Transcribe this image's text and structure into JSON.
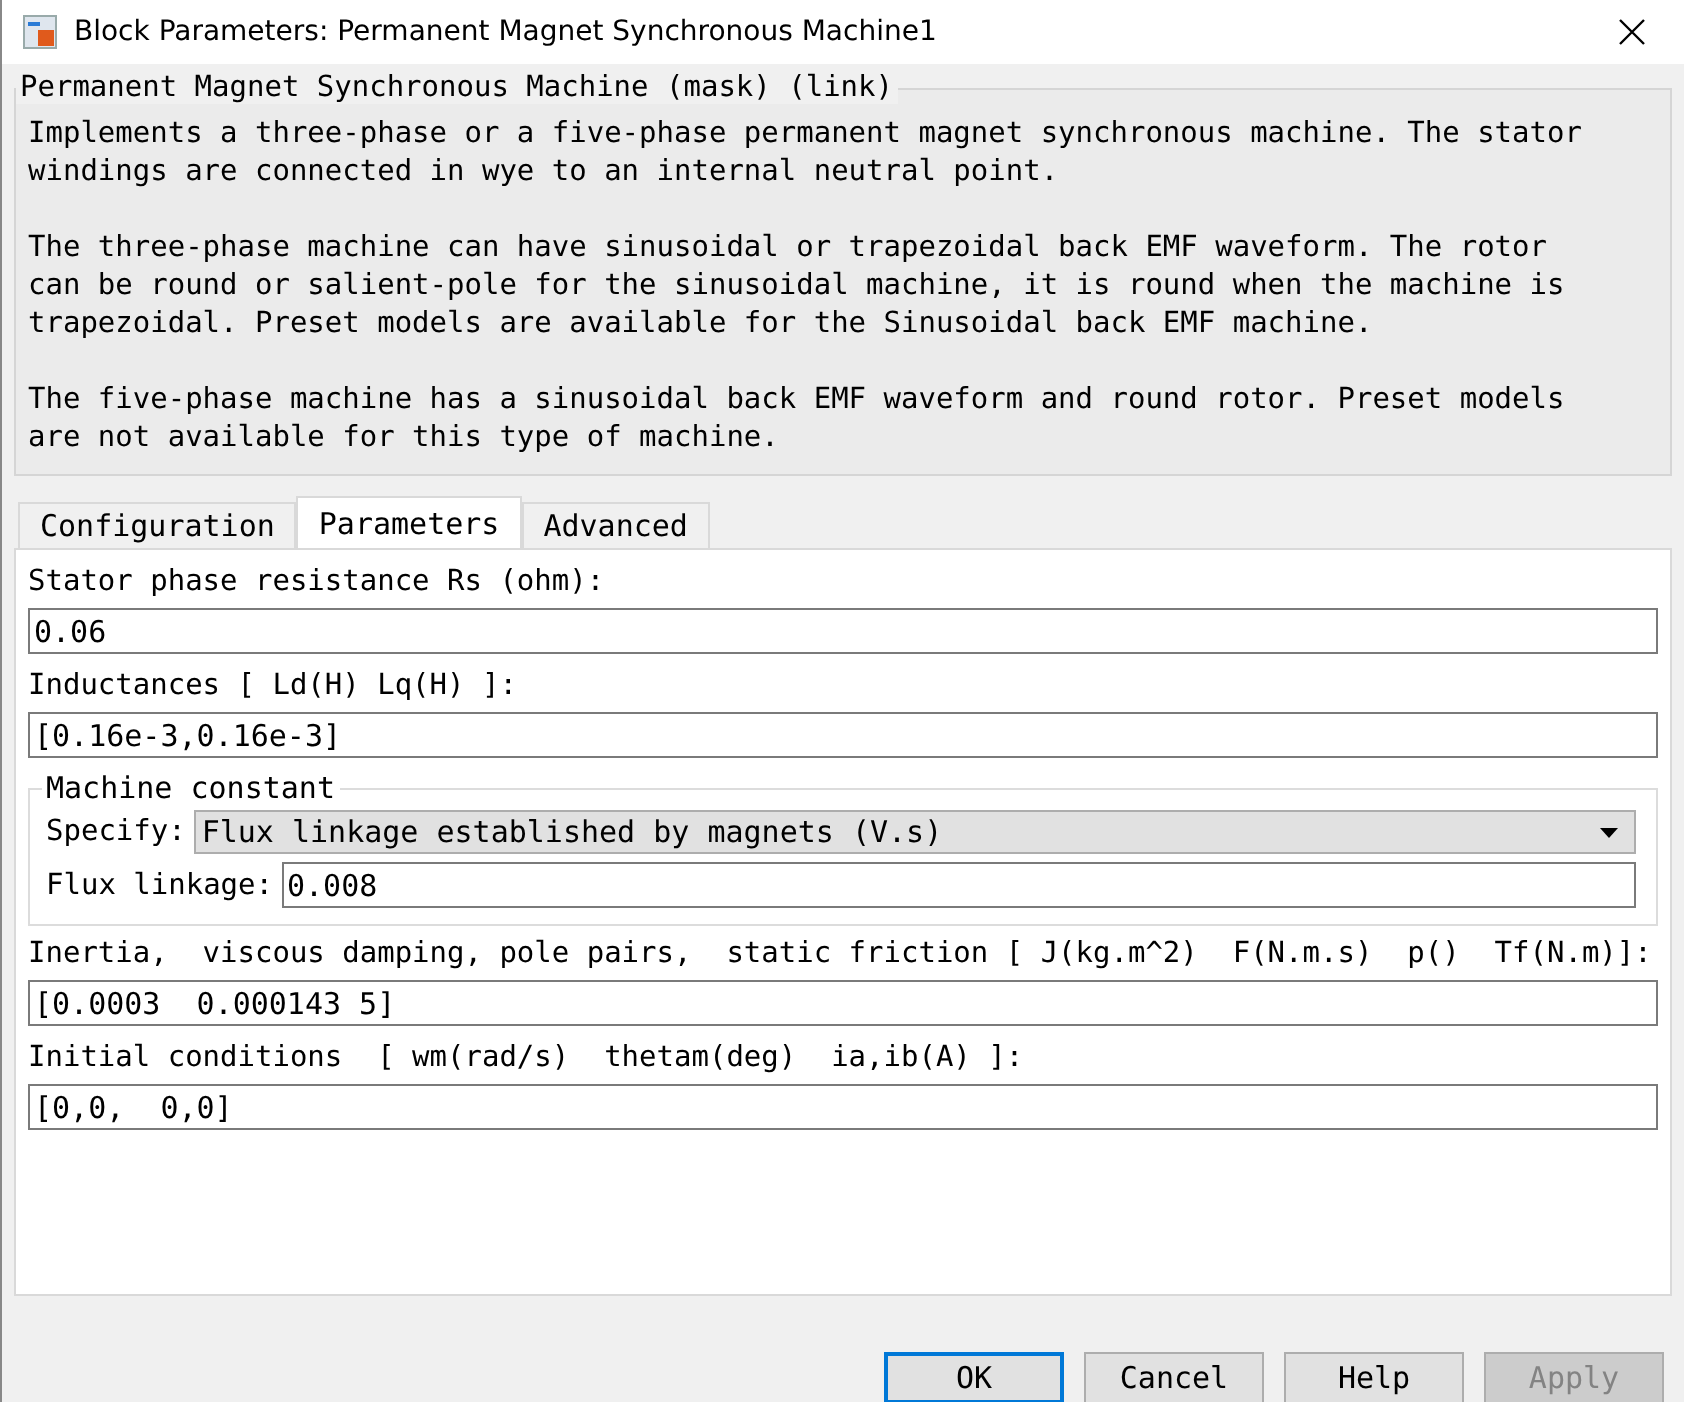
{
  "window": {
    "title": "Block Parameters: Permanent Magnet Synchronous Machine1"
  },
  "description": {
    "title": "Permanent Magnet Synchronous Machine (mask) (link)",
    "paragraphs": [
      "Implements a three-phase or a five-phase permanent magnet synchronous machine. The stator windings are connected in wye to an internal neutral point.",
      "The three-phase machine can have sinusoidal or trapezoidal back EMF waveform. The rotor can be round or salient-pole for the sinusoidal machine, it is round when the machine is trapezoidal. Preset models are available for the Sinusoidal back EMF machine.",
      "The five-phase machine has a sinusoidal back EMF waveform and round rotor. Preset models are not available for this type of machine."
    ]
  },
  "tabs": [
    {
      "label": "Configuration",
      "selected": false
    },
    {
      "label": "Parameters",
      "selected": true
    },
    {
      "label": "Advanced",
      "selected": false
    }
  ],
  "parameters": [
    {
      "kind": "text",
      "label": "Stator phase resistance Rs (ohm):",
      "value": "0.06"
    },
    {
      "kind": "text",
      "label": "Inductances [ Ld(H) Lq(H) ]:",
      "value": "[0.16e-3,0.16e-3]"
    },
    {
      "kind": "group",
      "title": "Machine constant",
      "items": [
        {
          "kind": "select",
          "label": "Specify:",
          "value": "Flux linkage established by magnets (V.s)"
        },
        {
          "kind": "inline",
          "label": "Flux linkage:",
          "value": "0.008"
        }
      ]
    },
    {
      "kind": "text",
      "label": "Inertia,  viscous damping, pole pairs,  static friction [ J(kg.m^2)  F(N.m.s)  p()  Tf(N.m)]:",
      "value": "[0.0003  0.000143 5]"
    },
    {
      "kind": "text",
      "label": "Initial conditions  [ wm(rad/s)  thetam(deg)  ia,ib(A) ]:",
      "value": "[0,0,  0,0]"
    }
  ],
  "buttons": [
    {
      "label": "OK",
      "focused": true,
      "disabled": false
    },
    {
      "label": "Cancel",
      "focused": false,
      "disabled": false
    },
    {
      "label": "Help",
      "focused": false,
      "disabled": false
    },
    {
      "label": "Apply",
      "focused": false,
      "disabled": true
    }
  ]
}
